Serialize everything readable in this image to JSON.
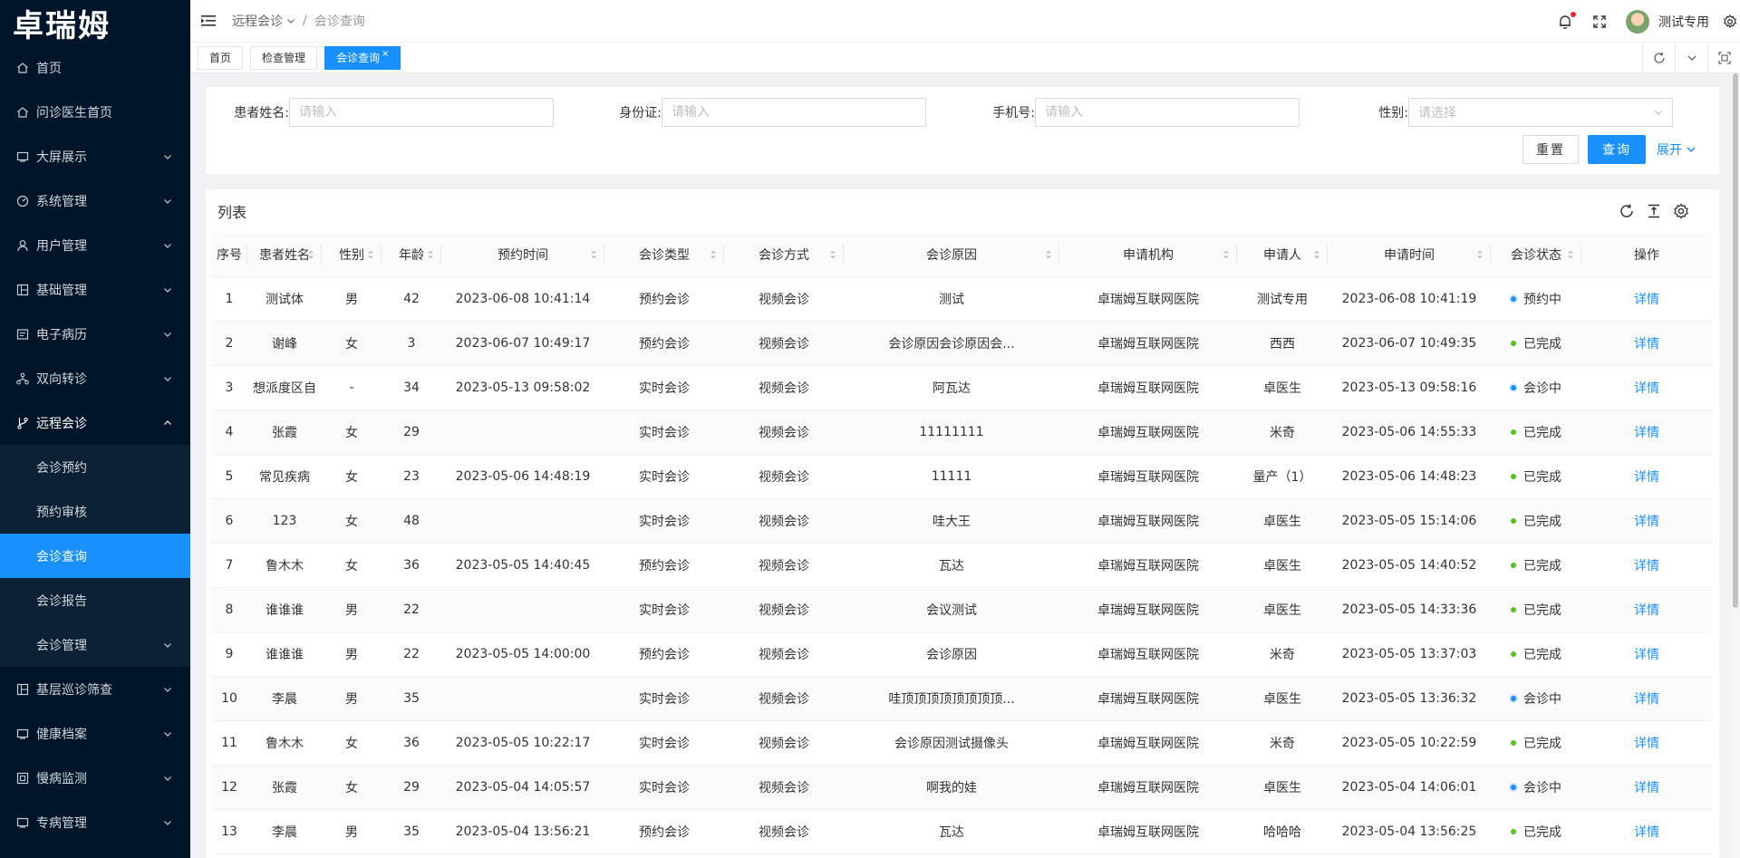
{
  "brand": "卓瑞姆",
  "sidebar": {
    "items": [
      {
        "label": "首页",
        "icon": "home-icon",
        "chev": false
      },
      {
        "label": "问诊医生首页",
        "icon": "home-icon",
        "chev": false
      },
      {
        "label": "大屏展示",
        "icon": "screen-icon",
        "chev": true
      },
      {
        "label": "系统管理",
        "icon": "dashboard-icon",
        "chev": true
      },
      {
        "label": "用户管理",
        "icon": "user-icon",
        "chev": true
      },
      {
        "label": "基础管理",
        "icon": "grid-icon",
        "chev": true
      },
      {
        "label": "电子病历",
        "icon": "record-icon",
        "chev": true
      },
      {
        "label": "双向转诊",
        "icon": "network-icon",
        "chev": true
      },
      {
        "label": "远程会诊",
        "icon": "branch-icon",
        "chev": true,
        "open": true
      }
    ],
    "submenu": [
      {
        "label": "会诊预约"
      },
      {
        "label": "预约审核"
      },
      {
        "label": "会诊查询",
        "active": true
      },
      {
        "label": "会诊报告"
      },
      {
        "label": "会诊管理",
        "chev": true
      }
    ],
    "items_after": [
      {
        "label": "基层巡诊筛查",
        "icon": "grid-icon",
        "chev": true
      },
      {
        "label": "健康档案",
        "icon": "screen-icon",
        "chev": true
      },
      {
        "label": "慢病监测",
        "icon": "monitor-icon",
        "chev": true
      },
      {
        "label": "专病管理",
        "icon": "screen-icon",
        "chev": true
      }
    ]
  },
  "topbar": {
    "breadcrumb_parent": "远程会诊",
    "breadcrumb_sep": "/",
    "breadcrumb_current": "会诊查询",
    "username": "测试专用"
  },
  "tabs": [
    {
      "label": "首页"
    },
    {
      "label": "检查管理"
    },
    {
      "label": "会诊查询",
      "active": true,
      "close": "×"
    }
  ],
  "search": {
    "name_label": "患者姓名:",
    "name_placeholder": "请输入",
    "id_label": "身份证:",
    "id_placeholder": "请输入",
    "phone_label": "手机号:",
    "phone_placeholder": "请输入",
    "gender_label": "性别:",
    "gender_placeholder": "请选择",
    "reset_label": "重置",
    "query_label": "查询",
    "expand_label": "展开"
  },
  "table": {
    "title": "列表",
    "columns": [
      "序号",
      "患者姓名",
      "性别",
      "年龄",
      "预约时间",
      "会诊类型",
      "会诊方式",
      "会诊原因",
      "申请机构",
      "申请人",
      "申请时间",
      "会诊状态",
      "操作"
    ],
    "rows": [
      {
        "no": "1",
        "name": "测试体",
        "gender": "男",
        "age": "42",
        "appt": "2023-06-08 10:41:14",
        "type": "预约会诊",
        "mode": "视频会诊",
        "reason": "测试",
        "org": "卓瑞姆互联网医院",
        "applicant": "测试专用",
        "apply_time": "2023-06-08 10:41:19",
        "status": "预约中",
        "status_color": "blue",
        "action": "详情"
      },
      {
        "no": "2",
        "name": "谢峰",
        "gender": "女",
        "age": "3",
        "appt": "2023-06-07 10:49:17",
        "type": "预约会诊",
        "mode": "视频会诊",
        "reason": "会诊原因会诊原因会...",
        "org": "卓瑞姆互联网医院",
        "applicant": "西西",
        "apply_time": "2023-06-07 10:49:35",
        "status": "已完成",
        "status_color": "green",
        "action": "详情"
      },
      {
        "no": "3",
        "name": "想派度区自",
        "gender": "-",
        "age": "34",
        "appt": "2023-05-13 09:58:02",
        "type": "实时会诊",
        "mode": "视频会诊",
        "reason": "阿瓦达",
        "org": "卓瑞姆互联网医院",
        "applicant": "卓医生",
        "apply_time": "2023-05-13 09:58:16",
        "status": "会诊中",
        "status_color": "blue",
        "action": "详情"
      },
      {
        "no": "4",
        "name": "张霞",
        "gender": "女",
        "age": "29",
        "appt": "",
        "type": "实时会诊",
        "mode": "视频会诊",
        "reason": "11111111",
        "org": "卓瑞姆互联网医院",
        "applicant": "米奇",
        "apply_time": "2023-05-06 14:55:33",
        "status": "已完成",
        "status_color": "green",
        "action": "详情"
      },
      {
        "no": "5",
        "name": "常见疾病",
        "gender": "女",
        "age": "23",
        "appt": "2023-05-06 14:48:19",
        "type": "实时会诊",
        "mode": "视频会诊",
        "reason": "11111",
        "org": "卓瑞姆互联网医院",
        "applicant": "量产（1）",
        "apply_time": "2023-05-06 14:48:23",
        "status": "已完成",
        "status_color": "green",
        "action": "详情"
      },
      {
        "no": "6",
        "name": "123",
        "gender": "女",
        "age": "48",
        "appt": "",
        "type": "实时会诊",
        "mode": "视频会诊",
        "reason": "哇大王",
        "org": "卓瑞姆互联网医院",
        "applicant": "卓医生",
        "apply_time": "2023-05-05 15:14:06",
        "status": "已完成",
        "status_color": "green",
        "action": "详情"
      },
      {
        "no": "7",
        "name": "鲁木木",
        "gender": "女",
        "age": "36",
        "appt": "2023-05-05 14:40:45",
        "type": "预约会诊",
        "mode": "视频会诊",
        "reason": "瓦达",
        "org": "卓瑞姆互联网医院",
        "applicant": "卓医生",
        "apply_time": "2023-05-05 14:40:52",
        "status": "已完成",
        "status_color": "green",
        "action": "详情"
      },
      {
        "no": "8",
        "name": "谁谁谁",
        "gender": "男",
        "age": "22",
        "appt": "",
        "type": "实时会诊",
        "mode": "视频会诊",
        "reason": "会议测试",
        "org": "卓瑞姆互联网医院",
        "applicant": "卓医生",
        "apply_time": "2023-05-05 14:33:36",
        "status": "已完成",
        "status_color": "green",
        "action": "详情"
      },
      {
        "no": "9",
        "name": "谁谁谁",
        "gender": "男",
        "age": "22",
        "appt": "2023-05-05 14:00:00",
        "type": "预约会诊",
        "mode": "视频会诊",
        "reason": "会诊原因",
        "org": "卓瑞姆互联网医院",
        "applicant": "米奇",
        "apply_time": "2023-05-05 13:37:03",
        "status": "已完成",
        "status_color": "green",
        "action": "详情"
      },
      {
        "no": "10",
        "name": "李晨",
        "gender": "男",
        "age": "35",
        "appt": "",
        "type": "实时会诊",
        "mode": "视频会诊",
        "reason": "哇顶顶顶顶顶顶顶顶...",
        "org": "卓瑞姆互联网医院",
        "applicant": "卓医生",
        "apply_time": "2023-05-05 13:36:32",
        "status": "会诊中",
        "status_color": "blue",
        "action": "详情"
      },
      {
        "no": "11",
        "name": "鲁木木",
        "gender": "女",
        "age": "36",
        "appt": "2023-05-05 10:22:17",
        "type": "实时会诊",
        "mode": "视频会诊",
        "reason": "会诊原因测试摄像头",
        "org": "卓瑞姆互联网医院",
        "applicant": "米奇",
        "apply_time": "2023-05-05 10:22:59",
        "status": "已完成",
        "status_color": "green",
        "action": "详情"
      },
      {
        "no": "12",
        "name": "张霞",
        "gender": "女",
        "age": "29",
        "appt": "2023-05-04 14:05:57",
        "type": "实时会诊",
        "mode": "视频会诊",
        "reason": "啊我的娃",
        "org": "卓瑞姆互联网医院",
        "applicant": "卓医生",
        "apply_time": "2023-05-04 14:06:01",
        "status": "会诊中",
        "status_color": "blue",
        "action": "详情"
      },
      {
        "no": "13",
        "name": "李晨",
        "gender": "男",
        "age": "35",
        "appt": "2023-05-04 13:56:21",
        "type": "预约会诊",
        "mode": "视频会诊",
        "reason": "瓦达",
        "org": "卓瑞姆互联网医院",
        "applicant": "哈哈哈",
        "apply_time": "2023-05-04 13:56:25",
        "status": "已完成",
        "status_color": "green",
        "action": "详情"
      }
    ]
  },
  "colors": {
    "sidebar_bg": "#001529",
    "accent": "#1890ff",
    "status_blue": "#1890ff",
    "status_green": "#52c41a"
  }
}
